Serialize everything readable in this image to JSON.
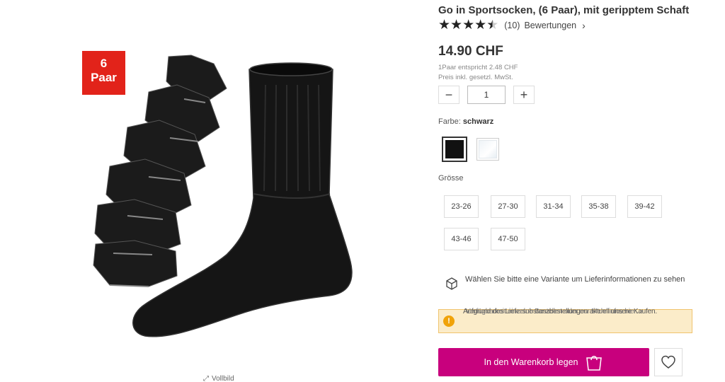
{
  "badge": {
    "line1": "6",
    "line2": "Paar"
  },
  "gallery": {
    "fullview_label": "Vollbild"
  },
  "product": {
    "title": "Go in Sportsocken, (6 Paar), mit geripptem Schaft",
    "rating_count": "(10)",
    "reviews_label": "Bewertungen",
    "rating_value": 4.5,
    "price": "14.90 CHF",
    "unit_price": "1Paar entspricht 2.48 CHF",
    "vat_note": "Preis inkl. gesetzl. MwSt."
  },
  "quantity": {
    "minus": "−",
    "value": "1",
    "plus": "+"
  },
  "color": {
    "label": "Farbe:",
    "selected": "schwarz",
    "swatches": [
      "schwarz",
      "weiss"
    ],
    "colors": {
      "black": "#111111",
      "white": "#ffffff"
    }
  },
  "size": {
    "label": "Grösse",
    "options": [
      "23-26",
      "27-30",
      "31-34",
      "35-38",
      "39-42",
      "43-46",
      "47-50"
    ]
  },
  "delivery": {
    "text": "Wählen Sie bitte eine Variante um Lieferinformationen zu sehen"
  },
  "alert": {
    "text_a": "Aufgrund des Liefersubstanzbestellungen aktuell unsere Kaufen. ",
    "text_b": "Verfügbarkeit einzelne Bestellen oder nur Mehr infos hier. >",
    "bg": "#fbecc9",
    "icon": "!"
  },
  "actions": {
    "cart_label": "In den Warenkorb legen",
    "cart_color": "#c8007d"
  }
}
